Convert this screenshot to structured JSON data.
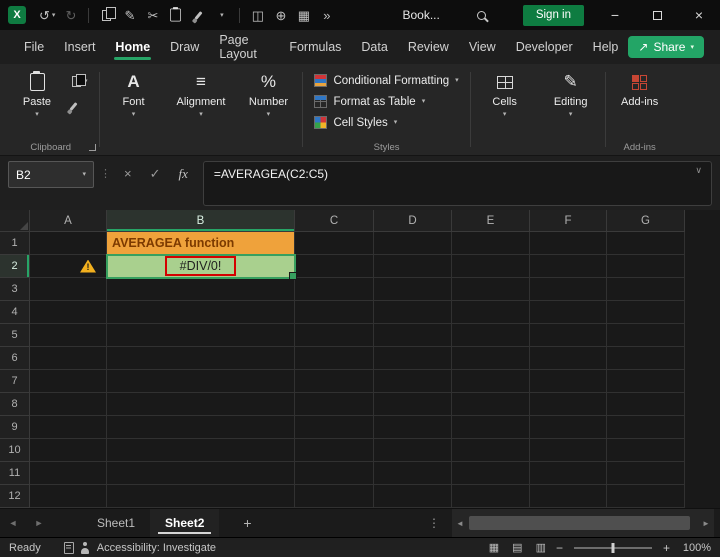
{
  "titlebar": {
    "workbook_name": "Book...",
    "sign_in": "Sign in"
  },
  "tabs": [
    "File",
    "Insert",
    "Home",
    "Draw",
    "Page Layout",
    "Formulas",
    "Data",
    "Review",
    "View",
    "Developer",
    "Help"
  ],
  "share_label": "Share",
  "ribbon": {
    "paste": "Paste",
    "font": "Font",
    "alignment": "Alignment",
    "number": "Number",
    "styles_items": [
      "Conditional Formatting",
      "Format as Table",
      "Cell Styles"
    ],
    "cells": "Cells",
    "editing": "Editing",
    "addins": "Add-ins",
    "labels": {
      "clipboard": "Clipboard",
      "styles": "Styles",
      "addins": "Add-ins"
    }
  },
  "formula_bar": {
    "name_box": "B2",
    "formula": "=AVERAGEA(C2:C5)"
  },
  "grid": {
    "columns": [
      "A",
      "B",
      "C",
      "D",
      "E",
      "F",
      "G"
    ],
    "row_count": 12,
    "active_col": "B",
    "active_row": 2,
    "selection": "B2",
    "error_indicator_cell": "A2",
    "cells": {
      "B1": {
        "text": "AVERAGEA function",
        "bg": "#EFA23B",
        "color": "#7C3A00",
        "bold": true
      },
      "B2": {
        "text": "#DIV/0!",
        "bg": "#A9D08E",
        "color": "#1F1F1F",
        "red_box": true
      }
    }
  },
  "sheets": {
    "tabs": [
      "Sheet1",
      "Sheet2"
    ],
    "active": "Sheet2"
  },
  "status": {
    "mode": "Ready",
    "accessibility": "Accessibility: Investigate",
    "zoom": "100%"
  },
  "colors": {
    "accent_green": "#27A567",
    "signin_green": "#0E7C41",
    "error_red": "#D40000",
    "warning_yellow": "#F2B01E",
    "cell_green": "#A9D08E",
    "cell_orange": "#EFA23B"
  },
  "icons": {
    "chevron_down": "▾",
    "undo": "↺",
    "redo": "↻",
    "cut": "✂",
    "pencil": "✎",
    "circle_plus": "⊕",
    "split_window": "◫",
    "table_grid": "▦",
    "overflow": "»",
    "dots_v": "⋮",
    "cancel": "×",
    "check": "✓",
    "fx": "fx",
    "font_a": "A",
    "align_lines": "≡",
    "percent": "%",
    "collapse_chevron": "∨",
    "tri_left": "◄",
    "tri_right": "►",
    "plus": "+",
    "minus": "−",
    "page_layout_view": "▤",
    "page_break_view": "▥",
    "share_arrow": "↗",
    "close": "×",
    "minimize": "−",
    "excel_logo": "X"
  }
}
